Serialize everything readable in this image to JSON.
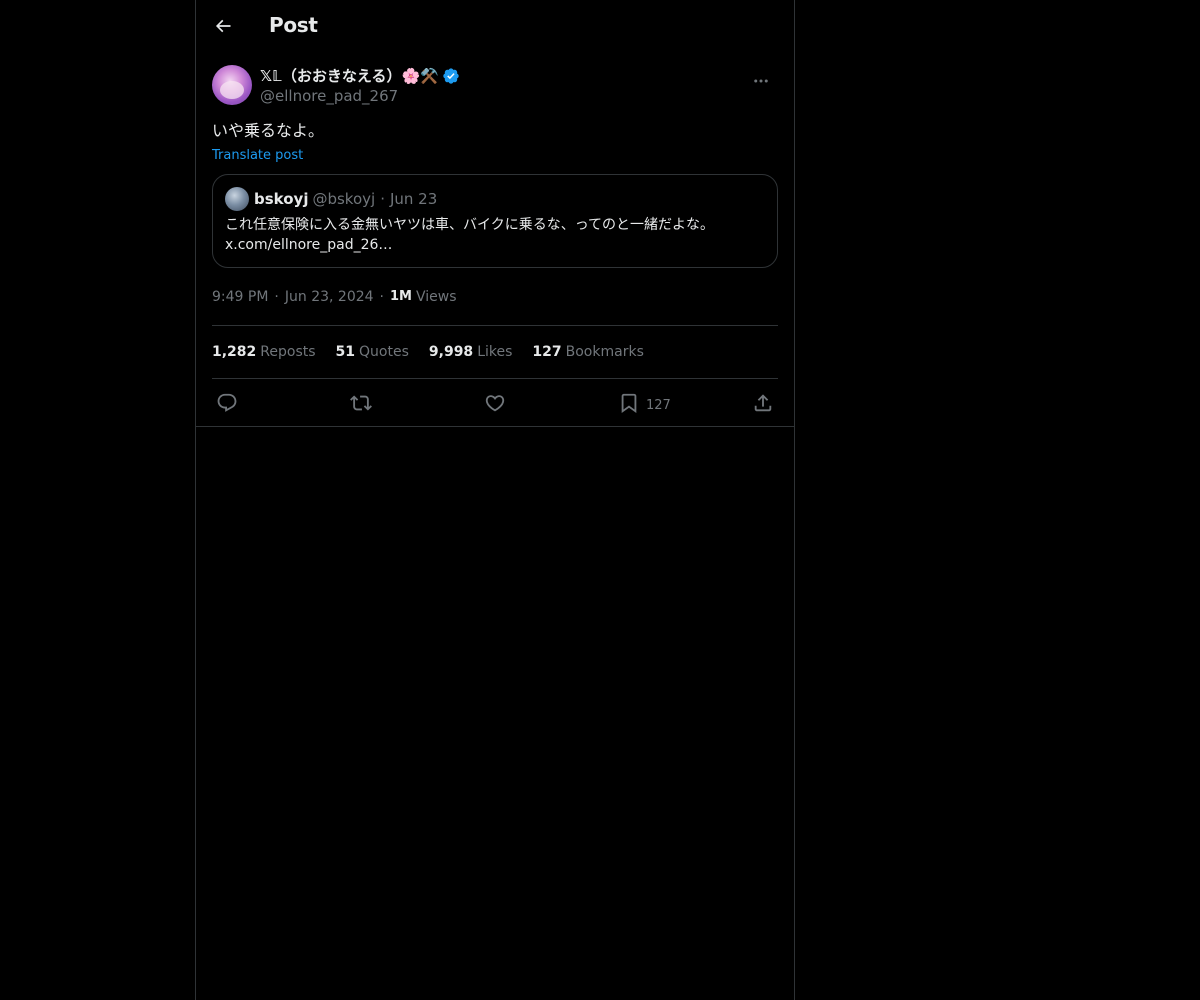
{
  "header": {
    "title": "Post",
    "back_icon": "arrow-left-icon"
  },
  "post": {
    "author": {
      "display_name": "𝕏𝕃（おおきなえる）🌸⚒️",
      "handle": "@ellnore_pad_267",
      "verified_icon": "verified-badge-icon",
      "verified_color": "#1d9bf0"
    },
    "text": "いや乗るなよ。",
    "translate_label": "Translate post",
    "quote": {
      "name": "bskoyj",
      "handle": "@bskoyj",
      "separator": "·",
      "date": "Jun 23",
      "text_line1": "これ任意保険に入る金無いヤツは車、バイクに乗るな、ってのと一緒だよな。",
      "text_line2": "x.com/ellnore_pad_26…"
    },
    "meta": {
      "time": "9:49 PM",
      "separator": "·",
      "date": "Jun 23, 2024",
      "views_count": "1M",
      "views_label": "Views"
    },
    "stats": [
      {
        "count": "1,282",
        "label": "Reposts"
      },
      {
        "count": "51",
        "label": "Quotes"
      },
      {
        "count": "9,998",
        "label": "Likes"
      },
      {
        "count": "127",
        "label": "Bookmarks"
      }
    ],
    "actions": {
      "reply_icon": "reply-icon",
      "repost_icon": "repost-icon",
      "like_icon": "heart-icon",
      "bookmark_icon": "bookmark-icon",
      "bookmark_count": "127",
      "share_icon": "share-icon"
    }
  },
  "colors": {
    "background": "#000000",
    "border": "#2f3336",
    "primary_text": "#e7e9ea",
    "secondary_text": "#71767b",
    "accent": "#1d9bf0"
  }
}
